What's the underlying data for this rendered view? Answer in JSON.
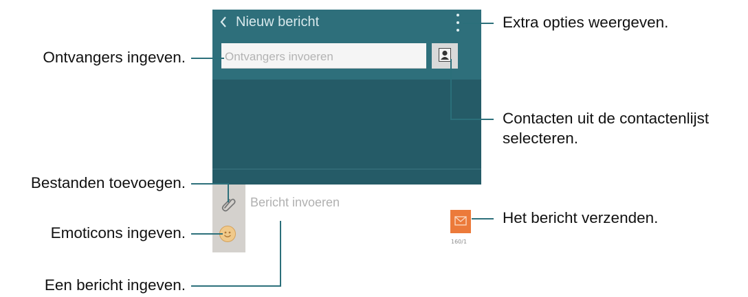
{
  "phone": {
    "title": "Nieuw bericht",
    "recipients_placeholder": "Ontvangers invoeren",
    "message_placeholder": "Bericht invoeren",
    "char_counter": "160/1"
  },
  "callouts": {
    "more_options": "Extra opties weergeven.",
    "recipients": "Ontvangers ingeven.",
    "contacts_line1": "Contacten uit de contactenlijst",
    "contacts_line2": "selecteren.",
    "attach": "Bestanden toevoegen.",
    "send": "Het bericht verzenden.",
    "emoticons": "Emoticons ingeven.",
    "message": "Een bericht ingeven."
  },
  "icons": {
    "back": "chevron-left-icon",
    "more": "more-vertical-icon",
    "contact": "contact-card-icon",
    "attach": "paperclip-icon",
    "emoticon": "smiley-icon",
    "send": "send-message-icon"
  },
  "colors": {
    "header": "#2e6f7b",
    "body": "#255b67",
    "leader_lines": "#2b6f7a",
    "send_button": "#ec7a3a"
  }
}
